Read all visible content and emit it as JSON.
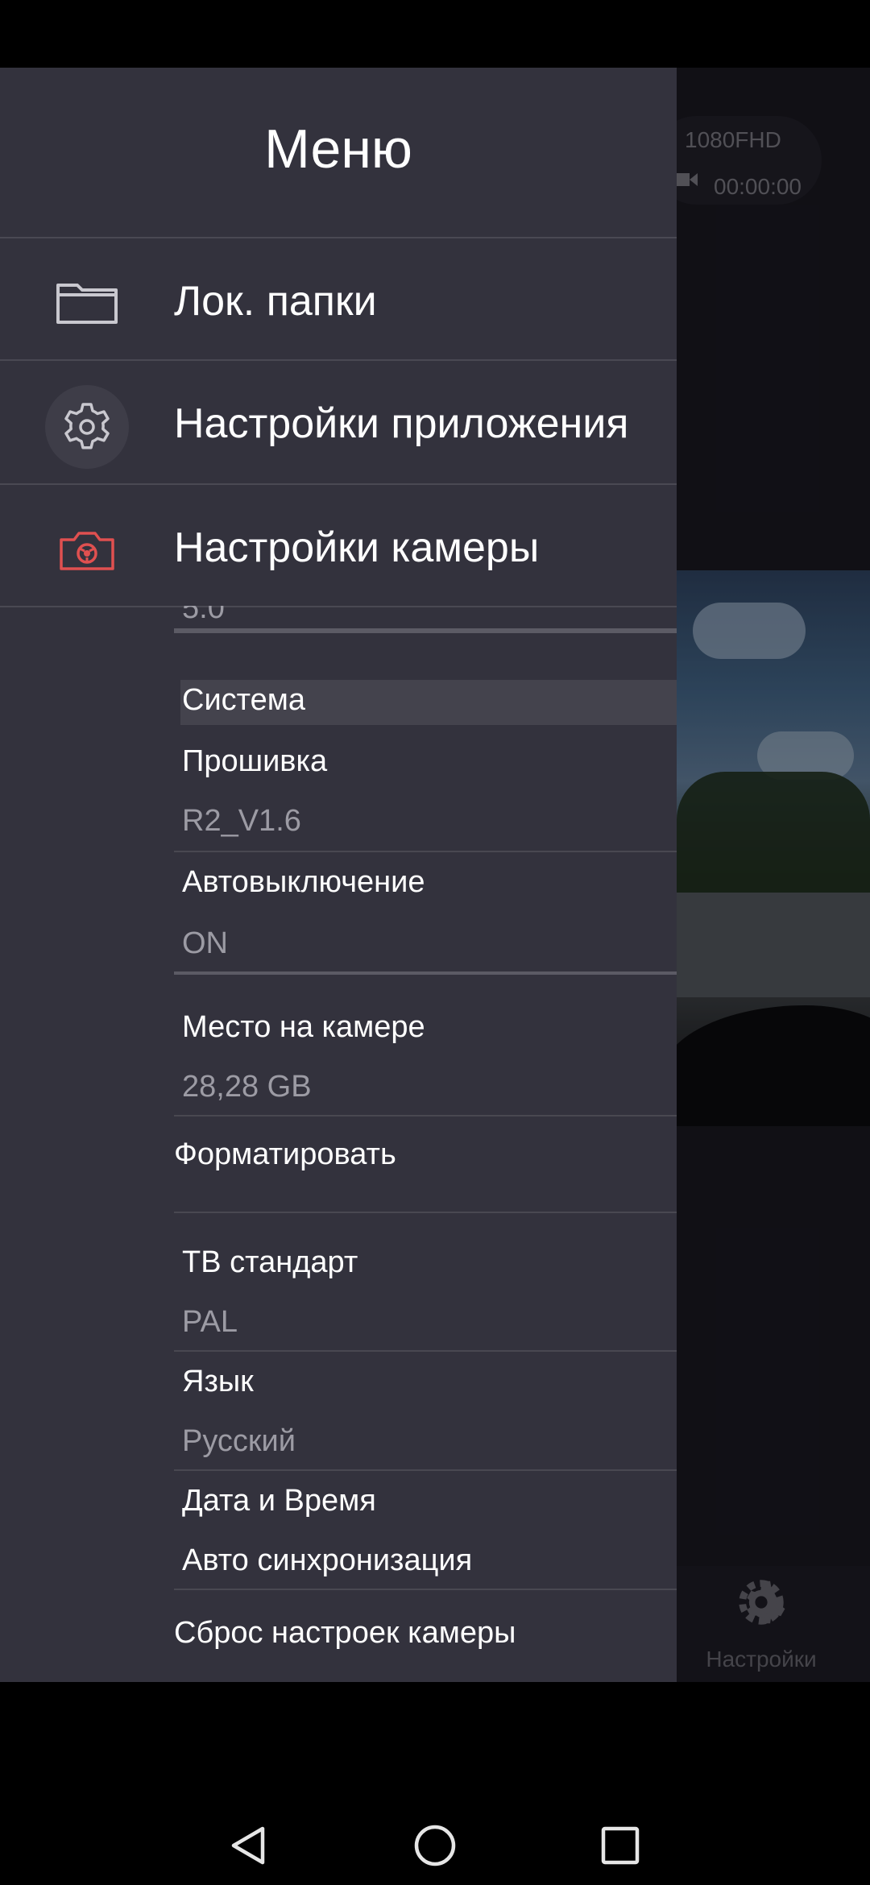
{
  "background": {
    "resolution": "1080FHD",
    "record_time": "00:00:00",
    "bottom_nav_label": "Настройки"
  },
  "drawer": {
    "title": "Меню",
    "items": [
      {
        "label": "Лок. папки",
        "icon": "folder-icon"
      },
      {
        "label": "Настройки приложения",
        "icon": "gear-icon"
      },
      {
        "label": "Настройки камеры",
        "icon": "camera-icon"
      }
    ]
  },
  "settings": {
    "cutoff_value": "5.0",
    "section": "Система",
    "firmware": {
      "title": "Прошивка",
      "value": "R2_V1.6"
    },
    "auto_off": {
      "title": "Автовыключение",
      "value": "ON"
    },
    "storage": {
      "title": "Место на камере",
      "value": "28,28 GB"
    },
    "format": "Форматировать",
    "tv_standard": {
      "title": "ТВ стандарт",
      "value": "PAL"
    },
    "language": {
      "title": "Язык",
      "value": "Русский"
    },
    "datetime": {
      "title": "Дата и Время",
      "value": "Авто синхронизация"
    },
    "reset": "Сброс настроек камеры"
  },
  "colors": {
    "drawer_bg": "#33323d",
    "camera_accent": "#e05050"
  }
}
